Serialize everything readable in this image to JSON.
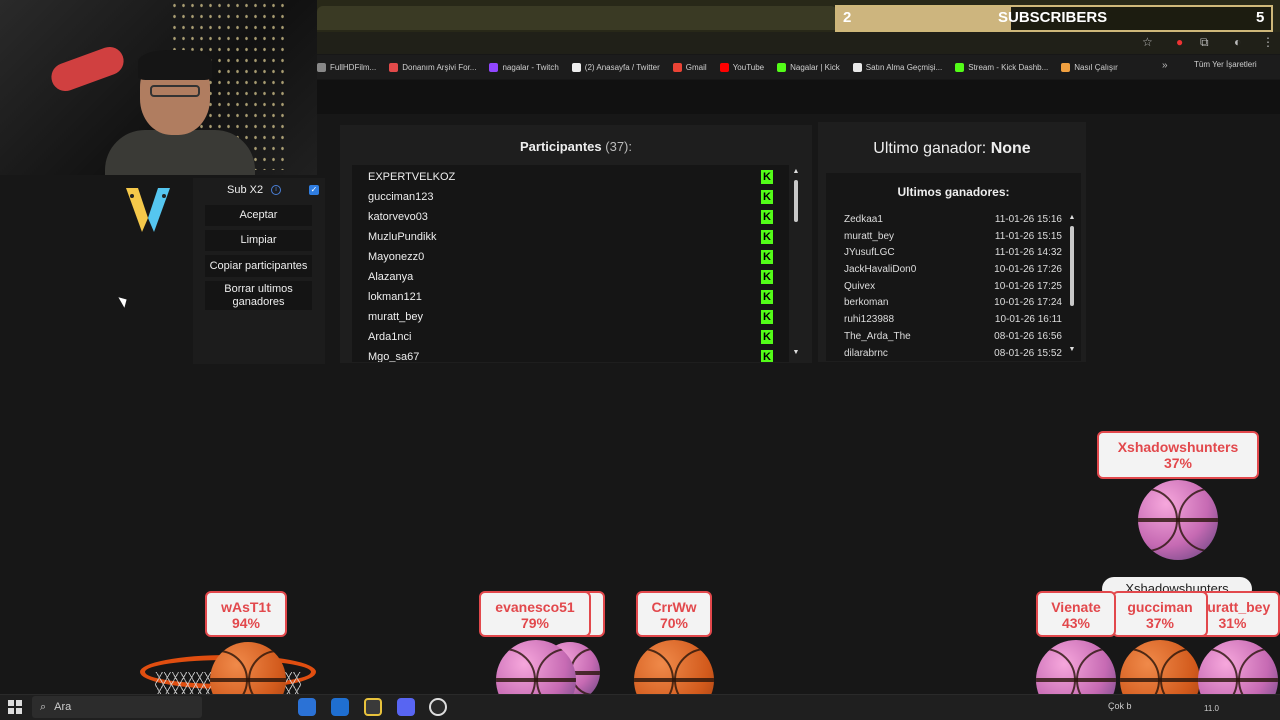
{
  "subscribers": {
    "count": "2",
    "label": "SUBSCRIBERS",
    "goal": "5",
    "progress": 0.4
  },
  "bookmarks": [
    {
      "label": "FullHDFilm...",
      "color": "#888"
    },
    {
      "label": "Donanım Arşivi For...",
      "color": "#e24a4a"
    },
    {
      "label": "nagalar - Twitch",
      "color": "#9146ff"
    },
    {
      "label": "(2) Anasayfa / Twitter",
      "color": "#eee"
    },
    {
      "label": "Gmail",
      "color": "#ea4335"
    },
    {
      "label": "YouTube",
      "color": "#ff0000"
    },
    {
      "label": "Nagalar | Kick",
      "color": "#53fc18"
    },
    {
      "label": "Satın Alma Geçmişi...",
      "color": "#e8e8e8"
    },
    {
      "label": "Stream - Kick Dashb...",
      "color": "#53fc18"
    },
    {
      "label": "Nasıl Çalışır",
      "color": "#f0a040"
    }
  ],
  "bookmarks_more": "»",
  "bookmarks_all": "Tüm Yer İşaretleri",
  "left_panel": {
    "sub_label": "Sub X2",
    "sub_checked": true,
    "accept": "Aceptar",
    "clear": "Limpiar",
    "copy": "Copiar participantes",
    "delete_winners": "Borrar ultimos ganadores"
  },
  "participants": {
    "title": "Participantes",
    "count": "(37):",
    "items": [
      "EXPERTVELKOZ",
      "gucciman123",
      "katorvevo03",
      "MuzluPundikk",
      "Mayonezz0",
      "Alazanya",
      "lokman121",
      "muratt_bey",
      "Arda1nci",
      "Mgo_sa67"
    ]
  },
  "winner": {
    "title_prefix": "Ultimo ganador:",
    "name": "None",
    "list_title": "Ultimos ganadores:",
    "items": [
      {
        "name": "Zedkaa1",
        "date": "11-01-26 15:16"
      },
      {
        "name": "muratt_bey",
        "date": "11-01-26 15:15"
      },
      {
        "name": "JYusufLGC",
        "date": "11-01-26 14:32"
      },
      {
        "name": "JackHavaliDon0",
        "date": "10-01-26 17:26"
      },
      {
        "name": "Quivex",
        "date": "10-01-26 17:25"
      },
      {
        "name": "berkoman",
        "date": "10-01-26 17:24"
      },
      {
        "name": "ruhi123988",
        "date": "10-01-26 16:11"
      },
      {
        "name": "The_Arda_The",
        "date": "08-01-26 16:56"
      },
      {
        "name": "dilarabrnc",
        "date": "08-01-26 15:52"
      }
    ]
  },
  "players": [
    {
      "name": "wAsT1t",
      "pct": "94%"
    },
    {
      "name": "evanesco51",
      "pct": "79%"
    },
    {
      "name": "CrrWw",
      "pct": "70%"
    },
    {
      "name": "Xshadowshunters",
      "pct": "37%"
    },
    {
      "name": "Vienate",
      "pct": "43%"
    },
    {
      "name": "gucciman",
      "pct": "37%"
    },
    {
      "name": "muratt_bey",
      "pct": "31%"
    }
  ],
  "tooltip": "Xshadowshunters",
  "taskbar": {
    "search": "Ara",
    "tray": "Çok b",
    "clock": "11.0"
  }
}
